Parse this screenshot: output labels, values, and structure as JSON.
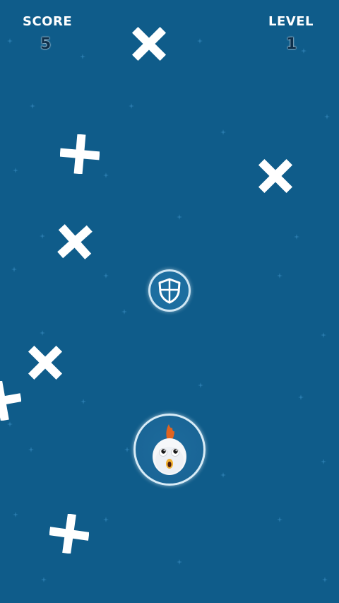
{
  "hud": {
    "score_label": "SCORE",
    "score_value": "5",
    "level_label": "LEVEL",
    "level_value": "1"
  },
  "colors": {
    "background": "#0f5c8a",
    "obstacle": "#ffffff",
    "hud_value": "#0d2f4b"
  },
  "icons": {
    "obstacle": "cross-obstacle-icon",
    "powerup": "shield-icon",
    "player": "chicken-icon"
  }
}
